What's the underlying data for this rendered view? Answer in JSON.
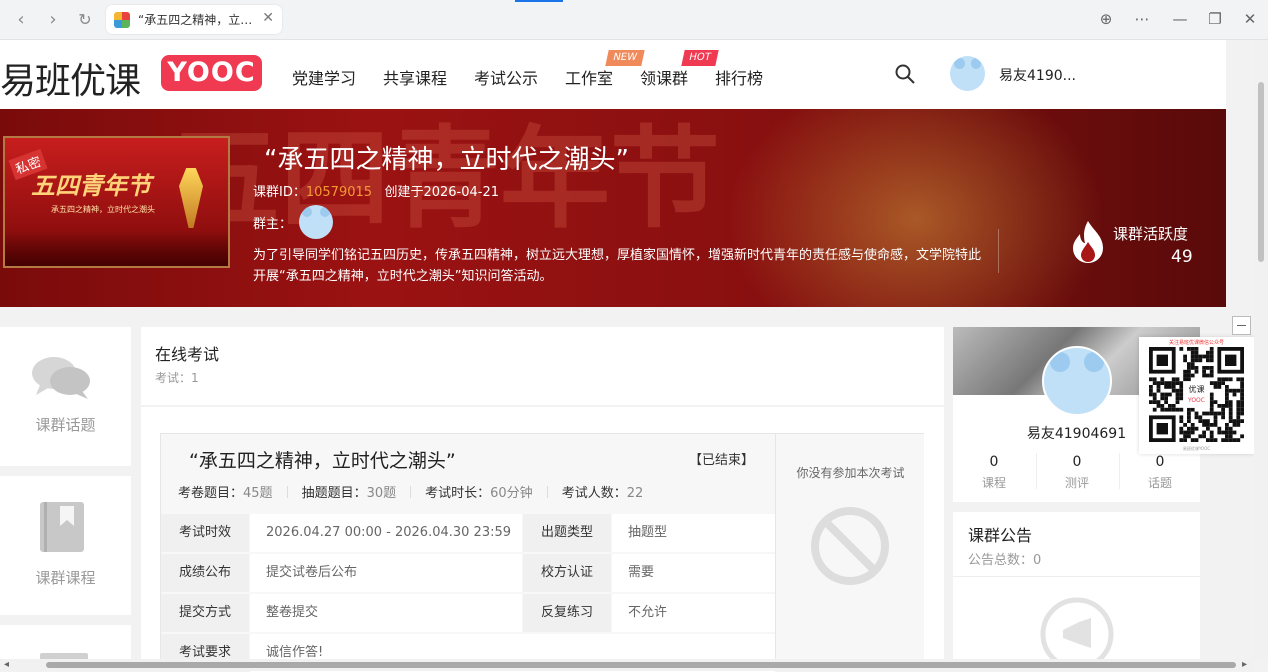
{
  "browser": {
    "tab_title": "“承五四之精神，立…",
    "back": "‹",
    "forward": "›",
    "reload": "↻",
    "tab_close": "✕",
    "controls": {
      "globe": "⊕",
      "more": "⋯",
      "minimize": "—",
      "restore": "❐",
      "close": "✕"
    }
  },
  "header": {
    "logo_cn": "易班优课",
    "logo_en": "YOOC",
    "nav": [
      "党建学习",
      "共享课程",
      "考试公示",
      "工作室",
      "领课群",
      "排行榜"
    ],
    "badge_new": "NEW",
    "badge_hot": "HOT",
    "username": "易友4190..."
  },
  "banner": {
    "title": "“承五四之精神，立时代之潮头”",
    "id_label": "课群ID：",
    "id_value": "10579015",
    "created": "创建于2026-04-21",
    "owner_label": "群主：",
    "description": "为了引导同学们铭记五四历史，传承五四精神，树立远大理想，厚植家国情怀，增强新时代青年的责任感与使命感，文学院特此开展“承五四之精神，立时代之潮头”知识问答活动。",
    "poster_title": "五四青年节",
    "poster_tag": "私密",
    "poster_sub": "承五四之精神，立时代之潮头",
    "activity_label": "课群活跃度",
    "activity_value": "49",
    "bg_text": "五四青年节"
  },
  "sidebar": {
    "topics": "课群话题",
    "courses": "课群课程"
  },
  "exams": {
    "heading": "在线考试",
    "count": "考试：1",
    "item": {
      "title": "“承五四之精神，立时代之潮头”",
      "status": "【已结束】",
      "stats": [
        {
          "label": "考卷题目：",
          "value": "45题"
        },
        {
          "label": "抽题题目：",
          "value": "30题"
        },
        {
          "label": "考试时长：",
          "value": "60分钟"
        },
        {
          "label": "考试人数：",
          "value": "22"
        }
      ],
      "rows": [
        {
          "k1": "考试时效",
          "v1": "2026.04.27 00:00 - 2026.04.30 23:59",
          "k2": "出题类型",
          "v2": "抽题型"
        },
        {
          "k1": "成绩公布",
          "v1": "提交试卷后公布",
          "k2": "校方认证",
          "v2": "需要"
        },
        {
          "k1": "提交方式",
          "v1": "整卷提交",
          "k2": "反复练习",
          "v2": "不允许"
        },
        {
          "k1": "考试要求",
          "v1": "诚信作答!",
          "k2": "",
          "v2": ""
        }
      ],
      "not_joined": "你没有参加本次考试"
    }
  },
  "profile": {
    "name": "易友41904691",
    "stats": [
      {
        "n": "0",
        "l": "课程"
      },
      {
        "n": "0",
        "l": "测评"
      },
      {
        "n": "0",
        "l": "话题"
      }
    ]
  },
  "notice": {
    "title": "课群公告",
    "count": "公告总数：0"
  },
  "qr": {
    "caption": "关注易班优课微信公众号",
    "footer": "易班优课YOOC",
    "center_text": "优课",
    "center_sub": "YOOC"
  },
  "colors": {
    "brand": "#ef3a52",
    "accent_orange": "#f39a35",
    "banner_red": "#9b1212"
  }
}
